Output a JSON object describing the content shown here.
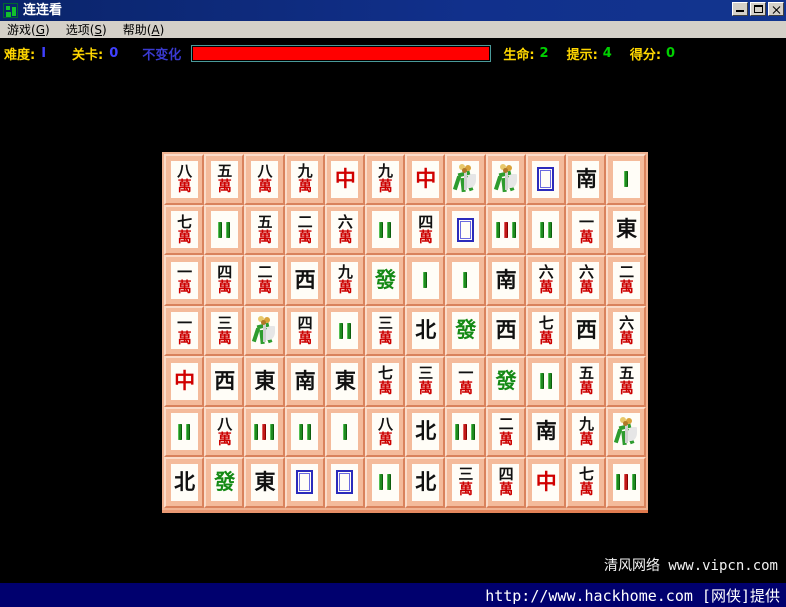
{
  "window": {
    "title": "连连看",
    "icon": "game-icon",
    "buttons": [
      {
        "name": "minimize",
        "glyph": "_"
      },
      {
        "name": "maximize",
        "glyph": "□"
      },
      {
        "name": "close",
        "glyph": "✕"
      }
    ]
  },
  "menubar": {
    "items": [
      {
        "label": "游戏",
        "accel": "G"
      },
      {
        "label": "选项",
        "accel": "S"
      },
      {
        "label": "帮助",
        "accel": "A"
      }
    ]
  },
  "status": {
    "difficulty_label": "难度:",
    "difficulty_value": "I",
    "level_label": "关卡:",
    "level_value": "0",
    "mode_label": "不变化",
    "progress_percent": 100,
    "progress_color": "#ff0000",
    "progress_border_color": "#4a9a9a",
    "life_label": "生命:",
    "life_value": "2",
    "hint_label": "提示:",
    "hint_value": "4",
    "score_label": "得分:",
    "score_value": "0"
  },
  "board": {
    "rows": 7,
    "cols": 12,
    "tiles": [
      [
        {
          "kind": "char",
          "top": "八",
          "bot": "萬"
        },
        {
          "kind": "char",
          "top": "五",
          "bot": "萬"
        },
        {
          "kind": "char",
          "top": "八",
          "bot": "萬"
        },
        {
          "kind": "char",
          "top": "九",
          "bot": "萬"
        },
        {
          "kind": "honor",
          "glyph": "中",
          "color": "red"
        },
        {
          "kind": "char",
          "top": "九",
          "bot": "萬"
        },
        {
          "kind": "honor",
          "glyph": "中",
          "color": "red"
        },
        {
          "kind": "flower"
        },
        {
          "kind": "flower"
        },
        {
          "kind": "blank"
        },
        {
          "kind": "honor",
          "glyph": "南",
          "color": "black"
        },
        {
          "kind": "bamboo",
          "count": 1
        }
      ],
      [
        {
          "kind": "char",
          "top": "七",
          "bot": "萬"
        },
        {
          "kind": "bamboo",
          "count": 2
        },
        {
          "kind": "char",
          "top": "五",
          "bot": "萬"
        },
        {
          "kind": "char",
          "top": "二",
          "bot": "萬"
        },
        {
          "kind": "char",
          "top": "六",
          "bot": "萬"
        },
        {
          "kind": "bamboo",
          "count": 2
        },
        {
          "kind": "char",
          "top": "四",
          "bot": "萬"
        },
        {
          "kind": "blank"
        },
        {
          "kind": "bamboo",
          "count": 5
        },
        {
          "kind": "bamboo",
          "count": 2
        },
        {
          "kind": "char",
          "top": "一",
          "bot": "萬"
        },
        {
          "kind": "honor",
          "glyph": "東",
          "color": "black"
        }
      ],
      [
        {
          "kind": "char",
          "top": "一",
          "bot": "萬"
        },
        {
          "kind": "char",
          "top": "四",
          "bot": "萬"
        },
        {
          "kind": "char",
          "top": "二",
          "bot": "萬"
        },
        {
          "kind": "honor",
          "glyph": "西",
          "color": "black"
        },
        {
          "kind": "char",
          "top": "九",
          "bot": "萬"
        },
        {
          "kind": "honor",
          "glyph": "發",
          "color": "green"
        },
        {
          "kind": "bamboo",
          "count": 1
        },
        {
          "kind": "bamboo",
          "count": 1
        },
        {
          "kind": "honor",
          "glyph": "南",
          "color": "black"
        },
        {
          "kind": "char",
          "top": "六",
          "bot": "萬"
        },
        {
          "kind": "char",
          "top": "六",
          "bot": "萬"
        },
        {
          "kind": "char",
          "top": "二",
          "bot": "萬"
        }
      ],
      [
        {
          "kind": "char",
          "top": "一",
          "bot": "萬"
        },
        {
          "kind": "char",
          "top": "三",
          "bot": "萬"
        },
        {
          "kind": "flower"
        },
        {
          "kind": "char",
          "top": "四",
          "bot": "萬"
        },
        {
          "kind": "bamboo",
          "count": 2
        },
        {
          "kind": "char",
          "top": "三",
          "bot": "萬"
        },
        {
          "kind": "honor",
          "glyph": "北",
          "color": "black"
        },
        {
          "kind": "honor",
          "glyph": "發",
          "color": "green"
        },
        {
          "kind": "honor",
          "glyph": "西",
          "color": "black"
        },
        {
          "kind": "char",
          "top": "七",
          "bot": "萬"
        },
        {
          "kind": "honor",
          "glyph": "西",
          "color": "black"
        },
        {
          "kind": "char",
          "top": "六",
          "bot": "萬"
        }
      ],
      [
        {
          "kind": "honor",
          "glyph": "中",
          "color": "red"
        },
        {
          "kind": "honor",
          "glyph": "西",
          "color": "black"
        },
        {
          "kind": "honor",
          "glyph": "東",
          "color": "black"
        },
        {
          "kind": "honor",
          "glyph": "南",
          "color": "black"
        },
        {
          "kind": "honor",
          "glyph": "東",
          "color": "black"
        },
        {
          "kind": "char",
          "top": "七",
          "bot": "萬"
        },
        {
          "kind": "char",
          "top": "三",
          "bot": "萬"
        },
        {
          "kind": "char",
          "top": "一",
          "bot": "萬"
        },
        {
          "kind": "honor",
          "glyph": "發",
          "color": "green"
        },
        {
          "kind": "bamboo",
          "count": 2
        },
        {
          "kind": "char",
          "top": "五",
          "bot": "萬"
        },
        {
          "kind": "char",
          "top": "五",
          "bot": "萬"
        }
      ],
      [
        {
          "kind": "bamboo",
          "count": 2
        },
        {
          "kind": "char",
          "top": "八",
          "bot": "萬"
        },
        {
          "kind": "bamboo",
          "count": 5
        },
        {
          "kind": "bamboo",
          "count": 2
        },
        {
          "kind": "bamboo",
          "count": 1
        },
        {
          "kind": "char",
          "top": "八",
          "bot": "萬"
        },
        {
          "kind": "honor",
          "glyph": "北",
          "color": "black"
        },
        {
          "kind": "bamboo",
          "count": 5
        },
        {
          "kind": "char",
          "top": "二",
          "bot": "萬"
        },
        {
          "kind": "honor",
          "glyph": "南",
          "color": "black"
        },
        {
          "kind": "char",
          "top": "九",
          "bot": "萬"
        },
        {
          "kind": "flower"
        }
      ],
      [
        {
          "kind": "honor",
          "glyph": "北",
          "color": "black"
        },
        {
          "kind": "honor",
          "glyph": "發",
          "color": "green"
        },
        {
          "kind": "honor",
          "glyph": "東",
          "color": "black"
        },
        {
          "kind": "blank"
        },
        {
          "kind": "blank"
        },
        {
          "kind": "bamboo",
          "count": 2
        },
        {
          "kind": "honor",
          "glyph": "北",
          "color": "black"
        },
        {
          "kind": "char",
          "top": "三",
          "bot": "萬"
        },
        {
          "kind": "char",
          "top": "四",
          "bot": "萬"
        },
        {
          "kind": "honor",
          "glyph": "中",
          "color": "red"
        },
        {
          "kind": "char",
          "top": "七",
          "bot": "萬"
        },
        {
          "kind": "bamboo",
          "count": 5
        }
      ]
    ]
  },
  "watermarks": {
    "top_line": "清风网络 www.vipcn.com",
    "bottom_line": "http://www.hackhome.com [网侠]提供"
  }
}
